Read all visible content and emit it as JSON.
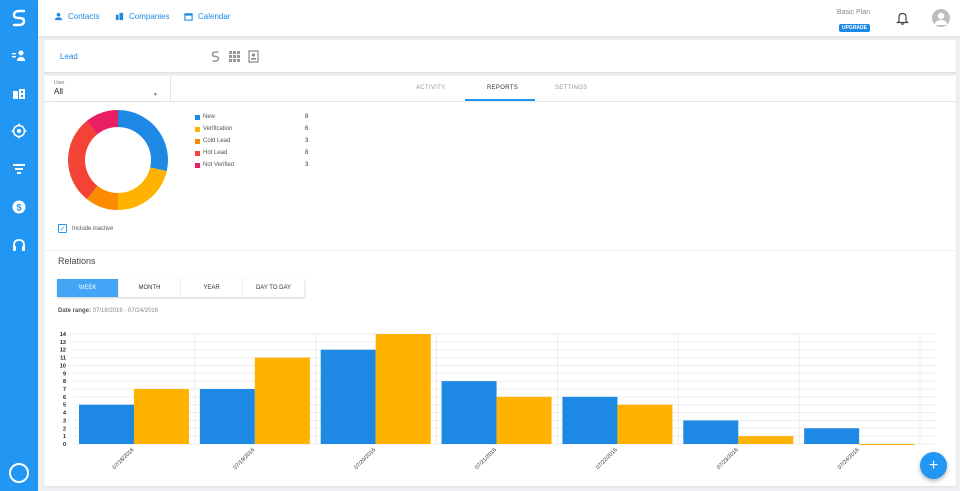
{
  "nav": {
    "contacts": "Contacts",
    "companies": "Companies",
    "calendar": "Calendar"
  },
  "account": {
    "plan_label": "Basic Plan",
    "upgrade_label": "UPGRADE"
  },
  "lead_bar": {
    "title": "Lead"
  },
  "filter": {
    "user_label": "User",
    "user_value": "All"
  },
  "tabs": [
    {
      "label": "ACTIVITY",
      "active": false
    },
    {
      "label": "REPORTS",
      "active": true
    },
    {
      "label": "SETTINGS",
      "active": false
    }
  ],
  "status_breakdown": {
    "items": [
      {
        "label": "New",
        "count": 8,
        "color": "#1e88e5"
      },
      {
        "label": "Verification",
        "count": 6,
        "color": "#ffb300"
      },
      {
        "label": "Cold Lead",
        "count": 3,
        "color": "#fb8c00"
      },
      {
        "label": "Hot Lead",
        "count": 8,
        "color": "#f44336"
      },
      {
        "label": "Not Verified",
        "count": 3,
        "color": "#e91e63"
      }
    ],
    "include_inactive_label": "Include inactive",
    "include_inactive_checked": true
  },
  "relations": {
    "title": "Relations",
    "periods": [
      {
        "label": "WEEK",
        "active": true
      },
      {
        "label": "MONTH",
        "active": false
      },
      {
        "label": "YEAR",
        "active": false
      },
      {
        "label": "DAY TO DAY",
        "active": false
      }
    ],
    "date_range_label": "Date range:",
    "date_range_value": "07/18/2016 - 07/24/2016"
  },
  "chart_data": {
    "type": "bar",
    "categories": [
      "07/18/2016",
      "07/19/2016",
      "07/20/2016",
      "07/21/2016",
      "07/22/2016",
      "07/23/2016",
      "07/24/2016"
    ],
    "series": [
      {
        "values": [
          5,
          7,
          12,
          8,
          6,
          3,
          2
        ],
        "color": "#1e88e5"
      },
      {
        "values": [
          7,
          11,
          14,
          6,
          5,
          1,
          0
        ],
        "color": "#ffb300"
      }
    ],
    "yticks": [
      0,
      1,
      2,
      3,
      4,
      5,
      6,
      7,
      8,
      9,
      10,
      11,
      12,
      13,
      14
    ],
    "ylim": [
      0,
      14
    ],
    "grid": true
  },
  "fab": {
    "label": "+"
  }
}
